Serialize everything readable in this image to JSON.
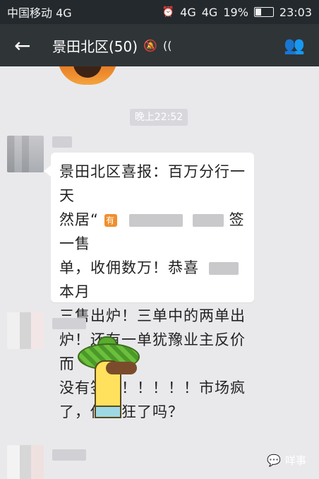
{
  "status_bar": {
    "carrier": "中国移动 4G",
    "network": "4G",
    "signal": "4G",
    "battery": "19%",
    "time": "23:03"
  },
  "header": {
    "back": "←",
    "title": "景田北区(50)",
    "mute": "🔕",
    "voice": "((",
    "people": "👥"
  },
  "conversation": {
    "timestamp": "晚上22:52",
    "message_line1": "景田北区喜报：百万分行一天",
    "message_line2_prefix": "然居“",
    "message_line2_suffix": "签一售",
    "message_line3_prefix": "单，收佣数万！恭喜",
    "message_line3_suffix": "本月",
    "message_line4": "三售出炉！三单中的两单出",
    "message_line5": "炉！还有一单犹豫业主反价而",
    "message_line6": "没有签成！！！！！市场疯",
    "message_line7": "了，你疯狂了吗？",
    "icon_text": "有"
  },
  "watermark": {
    "text": "咩事"
  },
  "icons": {
    "back": "arrow-left-icon",
    "mute": "mute-icon",
    "voice": "voice-icon",
    "people": "people-icon",
    "chat": "chat-icon"
  }
}
